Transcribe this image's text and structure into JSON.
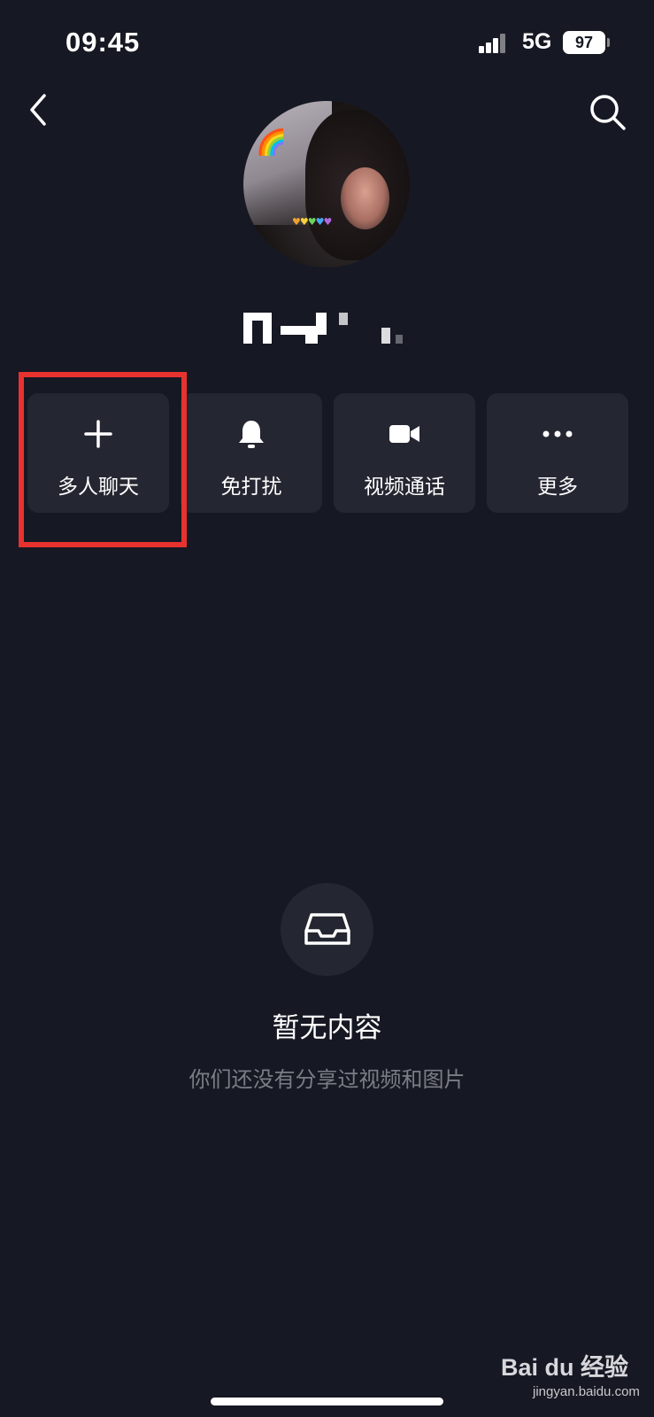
{
  "status_bar": {
    "time": "09:45",
    "network": "5G",
    "battery": "97"
  },
  "header": {
    "back_icon": "chevron-left-icon",
    "search_icon": "search-icon"
  },
  "profile": {
    "username": "",
    "avatar": "user-avatar"
  },
  "actions": [
    {
      "label": "多人聊天",
      "icon": "plus-icon",
      "highlighted": true
    },
    {
      "label": "免打扰",
      "icon": "bell-icon"
    },
    {
      "label": "视频通话",
      "icon": "video-camera-icon"
    },
    {
      "label": "更多",
      "icon": "more-dots-icon"
    }
  ],
  "empty_state": {
    "icon": "inbox-tray-icon",
    "title": "暂无内容",
    "subtitle": "你们还没有分享过视频和图片"
  },
  "watermark": {
    "brand": "Bai du 经验",
    "site": "jingyan.baidu.com"
  },
  "colors": {
    "background": "#161823",
    "card": "#242631",
    "highlight": "#e8322f",
    "secondary_text": "#7b7d86"
  }
}
